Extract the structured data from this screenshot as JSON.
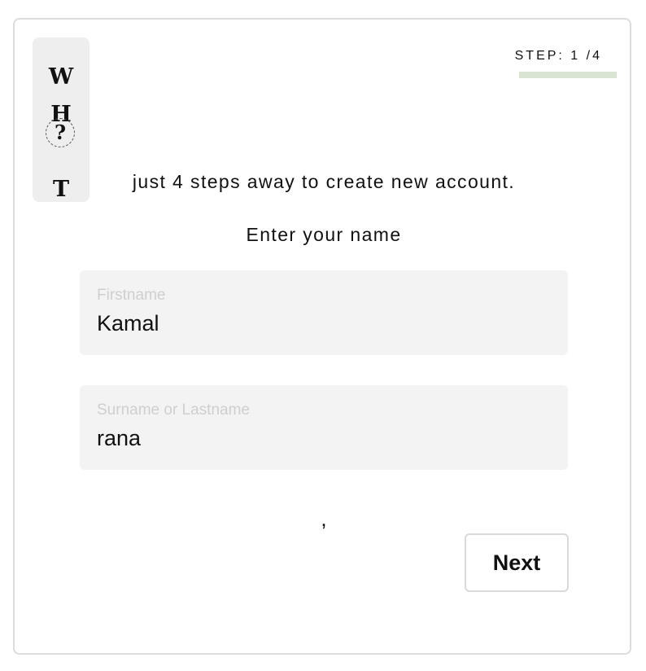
{
  "logo": {
    "letters": [
      "W",
      "H",
      "?",
      "T"
    ]
  },
  "step": {
    "text": "STEP: 1 /4"
  },
  "subtitle": "just 4 steps away to create new account.",
  "prompt": "Enter your name",
  "fields": [
    {
      "label": "Firstname",
      "value": "Kamal"
    },
    {
      "label": "Surname or Lastname",
      "value": "rana"
    }
  ],
  "separator": ",",
  "actions": {
    "next_label": "Next"
  },
  "colors": {
    "card_border": "#dcdcdc",
    "logo_bg": "#eeeeee",
    "step_bar": "#d8e5d2",
    "field_bg": "#f3f3f3",
    "field_label": "#cfcfcf",
    "text": "#111111"
  }
}
